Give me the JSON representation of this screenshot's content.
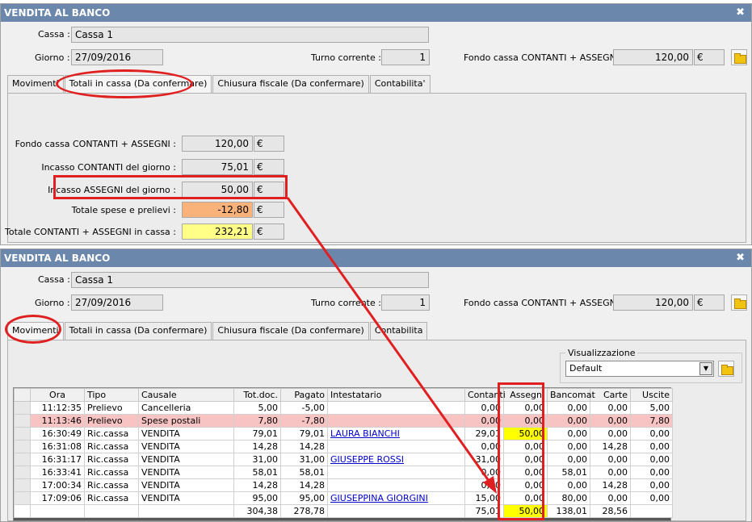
{
  "window_title": "VENDITA AL BANCO",
  "close_glyph": "✖",
  "header": {
    "cassa_label": "Cassa :",
    "cassa_value": "Cassa 1",
    "giorno_label": "Giorno :",
    "giorno_value": "27/09/2016",
    "turno_label": "Turno corrente :",
    "turno_value": "1",
    "fondo_label": "Fondo cassa CONTANTI + ASSEGNI :",
    "fondo_value": "120,00",
    "currency": "€"
  },
  "tabs_top": [
    "Movimenti",
    "Totali in cassa (Da confermare)",
    "Chiusura fiscale (Da confermare)",
    "Contabilita'"
  ],
  "tabs_bottom": [
    "Movimenti",
    "Totali in cassa (Da confermare)",
    "Chiusura fiscale (Da confermare)",
    "Contabilita"
  ],
  "totals": [
    {
      "label": "Fondo cassa CONTANTI + ASSEGNI :",
      "value": "120,00",
      "style": "normal"
    },
    {
      "label": "Incasso CONTANTI del giorno :",
      "value": "75,01",
      "style": "normal"
    },
    {
      "label": "Incasso ASSEGNI del giorno :",
      "value": "50,00",
      "style": "normal"
    },
    {
      "label": "Totale spese e prelievi :",
      "value": "-12,80",
      "style": "orange"
    },
    {
      "label": "Totale CONTANTI + ASSEGNI in cassa :",
      "value": "232,21",
      "style": "yellow"
    }
  ],
  "visualizzazione": {
    "legend": "Visualizzazione",
    "selected": "Default"
  },
  "grid": {
    "columns": [
      "Ora",
      "Tipo",
      "Causale",
      "Tot.doc.",
      "Pagato",
      "Intestatario",
      "Contanti",
      "Assegni",
      "Bancomat",
      "Carte",
      "Uscite"
    ],
    "rows": [
      {
        "cells": [
          "11:12:35",
          "Prelievo",
          "Cancelleria",
          "5,00",
          "-5,00",
          "",
          "0,00",
          "0,00",
          "0,00",
          "0,00",
          "5,00"
        ],
        "pink": false,
        "link": false,
        "assegni_yellow": false
      },
      {
        "cells": [
          "11:13:46",
          "Prelievo",
          "Spese postali",
          "7,80",
          "-7,80",
          "",
          "0,00",
          "0,00",
          "0,00",
          "0,00",
          "7,80"
        ],
        "pink": true,
        "link": false,
        "assegni_yellow": false
      },
      {
        "cells": [
          "16:30:49",
          "Ric.cassa",
          "VENDITA",
          "79,01",
          "79,01",
          "LAURA BIANCHI",
          "29,01",
          "50,00",
          "0,00",
          "0,00",
          "0,00"
        ],
        "pink": false,
        "link": true,
        "assegni_yellow": true
      },
      {
        "cells": [
          "16:31:08",
          "Ric.cassa",
          "VENDITA",
          "14,28",
          "14,28",
          "",
          "0,00",
          "0,00",
          "0,00",
          "14,28",
          "0,00"
        ],
        "pink": false,
        "link": false,
        "assegni_yellow": false
      },
      {
        "cells": [
          "16:31:17",
          "Ric.cassa",
          "VENDITA",
          "31,00",
          "31,00",
          "GIUSEPPE ROSSI",
          "31,00",
          "0,00",
          "0,00",
          "0,00",
          "0,00"
        ],
        "pink": false,
        "link": true,
        "assegni_yellow": false
      },
      {
        "cells": [
          "16:33:41",
          "Ric.cassa",
          "VENDITA",
          "58,01",
          "58,01",
          "",
          "0,00",
          "0,00",
          "58,01",
          "0,00",
          "0,00"
        ],
        "pink": false,
        "link": false,
        "assegni_yellow": false
      },
      {
        "cells": [
          "17:00:34",
          "Ric.cassa",
          "VENDITA",
          "14,28",
          "14,28",
          "",
          "0,00",
          "0,00",
          "0,00",
          "14,28",
          "0,00"
        ],
        "pink": false,
        "link": false,
        "assegni_yellow": false
      },
      {
        "cells": [
          "17:09:06",
          "Ric.cassa",
          "VENDITA",
          "95,00",
          "95,00",
          "GIUSEPPINA GIORGINI",
          "15,00",
          "0,00",
          "80,00",
          "0,00",
          "0,00"
        ],
        "pink": false,
        "link": true,
        "assegni_yellow": false
      }
    ],
    "total_row": [
      "",
      "",
      "",
      "304,38",
      "278,78",
      "",
      "75,01",
      "50,00",
      "138,01",
      "28,56",
      ""
    ]
  },
  "colors": {
    "title_bar": "#6b87ab",
    "highlight": "#e02020",
    "yellow": "#ffff00",
    "orange": "#f9b27a",
    "pink_row": "#f7c3c3"
  }
}
